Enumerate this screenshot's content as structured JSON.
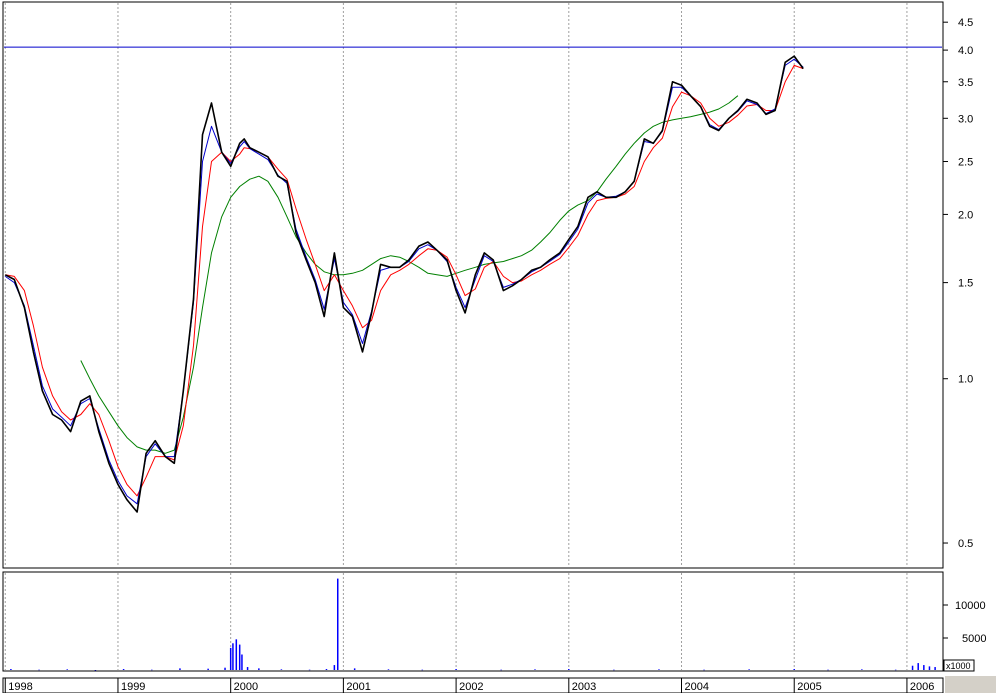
{
  "chart_data": {
    "type": "line",
    "title": "",
    "subtitle": "",
    "price_panel": {
      "scale": "log",
      "ylim": [
        0.45,
        4.9
      ],
      "y_ticks": [
        4.5,
        4.0,
        3.5,
        3.0,
        2.5,
        2.0,
        1.5,
        1.0,
        0.5
      ],
      "y_tick_labels": [
        "4.5",
        "4.0",
        "3.5",
        "3.0",
        "2.5",
        "2.0",
        "1.5",
        "1.0",
        "0.5"
      ],
      "reference_line": {
        "value": 4.05,
        "color": "#0000cc"
      },
      "series": [
        {
          "role": "price",
          "color": "#000000",
          "x": [
            1998.0,
            1998.08,
            1998.17,
            1998.25,
            1998.33,
            1998.42,
            1998.5,
            1998.58,
            1998.67,
            1998.75,
            1998.83,
            1998.92,
            1999.0,
            1999.08,
            1999.17,
            1999.25,
            1999.33,
            1999.42,
            1999.5,
            1999.58,
            1999.67,
            1999.75,
            1999.83,
            1999.92,
            2000.0,
            2000.08,
            2000.12,
            2000.17,
            2000.25,
            2000.33,
            2000.42,
            2000.5,
            2000.58,
            2000.67,
            2000.75,
            2000.83,
            2000.92,
            2001.0,
            2001.08,
            2001.17,
            2001.25,
            2001.33,
            2001.42,
            2001.5,
            2001.58,
            2001.67,
            2001.75,
            2001.83,
            2001.92,
            2002.0,
            2002.08,
            2002.17,
            2002.25,
            2002.33,
            2002.42,
            2002.5,
            2002.58,
            2002.67,
            2002.75,
            2002.83,
            2002.92,
            2003.0,
            2003.08,
            2003.17,
            2003.25,
            2003.33,
            2003.42,
            2003.5,
            2003.58,
            2003.67,
            2003.75,
            2003.83,
            2003.92,
            2004.0,
            2004.08,
            2004.17,
            2004.25,
            2004.33,
            2004.42,
            2004.5,
            2004.58,
            2004.67,
            2004.75,
            2004.83,
            2004.92,
            2005.0,
            2005.08,
            2005.17,
            2005.25,
            2005.33,
            2005.42,
            2005.5,
            2005.58,
            2005.67,
            2005.75,
            2005.83,
            2005.92,
            2006.0,
            2006.08,
            2006.17,
            2006.25,
            2006.3
          ],
          "y": [
            1.55,
            1.52,
            1.35,
            1.12,
            0.95,
            0.86,
            0.84,
            0.8,
            0.91,
            0.93,
            0.8,
            0.7,
            0.64,
            0.6,
            0.57,
            0.73,
            0.77,
            0.72,
            0.7,
            0.95,
            1.4,
            2.8,
            3.2,
            2.6,
            2.45,
            2.7,
            2.75,
            2.65,
            2.6,
            2.55,
            2.35,
            2.3,
            1.85,
            1.65,
            1.5,
            1.3,
            1.7,
            1.35,
            1.3,
            1.12,
            1.32,
            1.62,
            1.6,
            1.6,
            1.65,
            1.75,
            1.78,
            1.72,
            1.65,
            1.45,
            1.32,
            1.55,
            1.7,
            1.65,
            1.45,
            1.48,
            1.52,
            1.58,
            1.6,
            1.65,
            1.7,
            1.8,
            1.9,
            2.15,
            2.2,
            2.15,
            2.15,
            2.2,
            2.3,
            2.75,
            2.7,
            2.85,
            3.5,
            3.45,
            3.3,
            3.15,
            2.9,
            2.85,
            3.0,
            3.1,
            3.25,
            3.2,
            3.05,
            3.1,
            3.8,
            3.9,
            3.7
          ]
        },
        {
          "role": "fast moving average",
          "color": "#0000cc",
          "x": [
            1998.0,
            1998.08,
            1998.17,
            1998.25,
            1998.33,
            1998.42,
            1998.5,
            1998.58,
            1998.67,
            1998.75,
            1998.83,
            1998.92,
            1999.0,
            1999.08,
            1999.17,
            1999.25,
            1999.33,
            1999.42,
            1999.5,
            1999.58,
            1999.67,
            1999.75,
            1999.83,
            1999.92,
            2000.0,
            2000.08,
            2000.12,
            2000.17,
            2000.25,
            2000.33,
            2000.42,
            2000.5,
            2000.58,
            2000.67,
            2000.75,
            2000.83,
            2000.92,
            2001.0,
            2001.08,
            2001.17,
            2001.25,
            2001.33,
            2001.42,
            2001.5,
            2001.58,
            2001.67,
            2001.75,
            2001.83,
            2001.92,
            2002.0,
            2002.08,
            2002.17,
            2002.25,
            2002.33,
            2002.42,
            2002.5,
            2002.58,
            2002.67,
            2002.75,
            2002.83,
            2002.92,
            2003.0,
            2003.08,
            2003.17,
            2003.25,
            2003.33,
            2003.42,
            2003.5,
            2003.58,
            2003.67,
            2003.75,
            2003.83,
            2003.92,
            2004.0,
            2004.08,
            2004.17,
            2004.25,
            2004.33,
            2004.42,
            2004.5,
            2004.58,
            2004.67,
            2004.75,
            2004.83,
            2004.92,
            2005.0,
            2005.08,
            2005.17,
            2005.25,
            2005.33,
            2005.42,
            2005.5,
            2005.58,
            2005.67,
            2005.75,
            2005.83,
            2005.92,
            2006.0,
            2006.08,
            2006.17,
            2006.25,
            2006.3
          ],
          "y": [
            1.54,
            1.5,
            1.36,
            1.15,
            0.97,
            0.88,
            0.85,
            0.82,
            0.9,
            0.92,
            0.81,
            0.71,
            0.65,
            0.61,
            0.59,
            0.72,
            0.76,
            0.72,
            0.72,
            0.95,
            1.38,
            2.5,
            2.9,
            2.6,
            2.48,
            2.66,
            2.72,
            2.64,
            2.58,
            2.52,
            2.36,
            2.28,
            1.88,
            1.67,
            1.52,
            1.34,
            1.66,
            1.38,
            1.31,
            1.16,
            1.33,
            1.58,
            1.6,
            1.6,
            1.64,
            1.73,
            1.76,
            1.72,
            1.64,
            1.47,
            1.35,
            1.52,
            1.68,
            1.64,
            1.47,
            1.49,
            1.52,
            1.57,
            1.6,
            1.64,
            1.69,
            1.78,
            1.88,
            2.1,
            2.18,
            2.15,
            2.16,
            2.2,
            2.3,
            2.72,
            2.7,
            2.84,
            3.42,
            3.42,
            3.3,
            3.15,
            2.92,
            2.86,
            3.0,
            3.09,
            3.23,
            3.18,
            3.06,
            3.12,
            3.75,
            3.85,
            3.72
          ]
        },
        {
          "role": "medium moving average",
          "color": "#ff0000",
          "x": [
            1998.0,
            1998.08,
            1998.17,
            1998.25,
            1998.33,
            1998.42,
            1998.5,
            1998.58,
            1998.67,
            1998.75,
            1998.83,
            1998.92,
            1999.0,
            1999.08,
            1999.17,
            1999.25,
            1999.33,
            1999.42,
            1999.5,
            1999.58,
            1999.67,
            1999.75,
            1999.83,
            1999.92,
            2000.0,
            2000.08,
            2000.12,
            2000.17,
            2000.25,
            2000.33,
            2000.42,
            2000.5,
            2000.58,
            2000.67,
            2000.75,
            2000.83,
            2000.92,
            2001.0,
            2001.08,
            2001.17,
            2001.25,
            2001.33,
            2001.42,
            2001.5,
            2001.58,
            2001.67,
            2001.75,
            2001.83,
            2001.92,
            2002.0,
            2002.08,
            2002.17,
            2002.25,
            2002.33,
            2002.42,
            2002.5,
            2002.58,
            2002.67,
            2002.75,
            2002.83,
            2002.92,
            2003.0,
            2003.08,
            2003.17,
            2003.25,
            2003.33,
            2003.42,
            2003.5,
            2003.58,
            2003.67,
            2003.75,
            2003.83,
            2003.92,
            2004.0,
            2004.08,
            2004.17,
            2004.25,
            2004.33,
            2004.42,
            2004.5,
            2004.58,
            2004.67,
            2004.75,
            2004.83,
            2004.92,
            2005.0,
            2005.08,
            2005.17,
            2005.25,
            2005.33,
            2005.42,
            2005.5,
            2005.58,
            2005.67,
            2005.75,
            2005.83,
            2005.92,
            2006.0,
            2006.08,
            2006.17,
            2006.25,
            2006.3
          ],
          "y": [
            1.55,
            1.54,
            1.45,
            1.25,
            1.05,
            0.93,
            0.87,
            0.84,
            0.86,
            0.9,
            0.86,
            0.77,
            0.69,
            0.64,
            0.61,
            0.66,
            0.72,
            0.72,
            0.71,
            0.82,
            1.15,
            1.9,
            2.5,
            2.6,
            2.5,
            2.58,
            2.65,
            2.64,
            2.6,
            2.55,
            2.42,
            2.32,
            2.05,
            1.8,
            1.62,
            1.45,
            1.55,
            1.45,
            1.36,
            1.24,
            1.28,
            1.45,
            1.55,
            1.58,
            1.62,
            1.68,
            1.73,
            1.72,
            1.67,
            1.55,
            1.42,
            1.46,
            1.6,
            1.64,
            1.54,
            1.5,
            1.51,
            1.55,
            1.58,
            1.62,
            1.66,
            1.74,
            1.83,
            2.0,
            2.12,
            2.14,
            2.15,
            2.18,
            2.25,
            2.5,
            2.65,
            2.76,
            3.15,
            3.35,
            3.3,
            3.2,
            3.0,
            2.9,
            2.95,
            3.04,
            3.16,
            3.18,
            3.1,
            3.1,
            3.5,
            3.75,
            3.7
          ]
        },
        {
          "role": "slow moving average",
          "color": "#008000",
          "x": [
            1998.67,
            1998.75,
            1998.83,
            1998.92,
            1999.0,
            1999.08,
            1999.17,
            1999.25,
            1999.33,
            1999.42,
            1999.5,
            1999.58,
            1999.67,
            1999.75,
            1999.83,
            1999.92,
            2000.0,
            2000.08,
            2000.17,
            2000.25,
            2000.33,
            2000.42,
            2000.5,
            2000.58,
            2000.67,
            2000.75,
            2000.83,
            2000.92,
            2001.0,
            2001.08,
            2001.17,
            2001.25,
            2001.33,
            2001.42,
            2001.5,
            2001.58,
            2001.67,
            2001.75,
            2001.83,
            2001.92,
            2002.0,
            2002.08,
            2002.17,
            2002.25,
            2002.33,
            2002.42,
            2002.5,
            2002.58,
            2002.67,
            2002.75,
            2002.83,
            2002.92,
            2003.0,
            2003.08,
            2003.17,
            2003.25,
            2003.33,
            2003.42,
            2003.5,
            2003.58,
            2003.67,
            2003.75,
            2003.83,
            2003.92,
            2004.0,
            2004.08,
            2004.17,
            2004.25,
            2004.33,
            2004.42,
            2004.5,
            2004.58,
            2004.67,
            2004.75,
            2004.83,
            2004.92,
            2005.0,
            2005.08,
            2005.17,
            2005.25,
            2005.33,
            2005.42,
            2005.5,
            2005.58,
            2005.67,
            2005.75,
            2005.83,
            2005.92,
            2006.0,
            2006.08,
            2006.17,
            2006.25,
            2006.3
          ],
          "y": [
            1.08,
            1.0,
            0.93,
            0.87,
            0.82,
            0.78,
            0.75,
            0.74,
            0.74,
            0.73,
            0.74,
            0.85,
            1.05,
            1.35,
            1.7,
            1.98,
            2.15,
            2.25,
            2.32,
            2.35,
            2.3,
            2.15,
            1.98,
            1.82,
            1.7,
            1.62,
            1.57,
            1.55,
            1.55,
            1.56,
            1.58,
            1.62,
            1.66,
            1.68,
            1.67,
            1.64,
            1.6,
            1.56,
            1.55,
            1.54,
            1.56,
            1.58,
            1.6,
            1.62,
            1.63,
            1.64,
            1.66,
            1.68,
            1.72,
            1.78,
            1.85,
            1.95,
            2.03,
            2.08,
            2.12,
            2.2,
            2.32,
            2.45,
            2.58,
            2.7,
            2.82,
            2.9,
            2.95,
            2.98,
            3.0,
            3.02,
            3.05,
            3.08,
            3.12,
            3.2,
            3.3
          ]
        }
      ]
    },
    "volume_panel": {
      "y_ticks": [
        5000,
        10000
      ],
      "y_tick_labels": [
        "5000",
        "10000"
      ],
      "ylim": [
        0,
        15000
      ],
      "unit_label": "x1000",
      "color": "#0000ff",
      "x": [
        1998.05,
        1998.3,
        1998.55,
        1998.8,
        1999.05,
        1999.3,
        1999.55,
        1999.8,
        1999.95,
        2000.0,
        2000.02,
        2000.05,
        2000.08,
        2000.1,
        2000.15,
        2000.25,
        2000.45,
        2000.7,
        2000.85,
        2000.92,
        2000.95,
        2001.1,
        2001.4,
        2001.7,
        2002.0,
        2002.4,
        2002.7,
        2003.0,
        2003.4,
        2003.8,
        2004.2,
        2004.6,
        2005.0,
        2005.3,
        2005.6,
        2005.9,
        2006.05,
        2006.1,
        2006.15,
        2006.2,
        2006.25
      ],
      "values": [
        300,
        200,
        250,
        150,
        300,
        200,
        400,
        350,
        500,
        3500,
        4200,
        4800,
        4000,
        2500,
        600,
        400,
        250,
        200,
        300,
        900,
        14000,
        400,
        250,
        200,
        300,
        200,
        250,
        300,
        200,
        250,
        200,
        250,
        300,
        200,
        250,
        200,
        800,
        1200,
        900,
        700,
        600
      ]
    },
    "x_axis": {
      "type": "date",
      "xlim": [
        1997.98,
        2006.32
      ],
      "ticks": [
        1998.0,
        1999.0,
        2000.0,
        2001.0,
        2002.0,
        2003.0,
        2004.0,
        2005.0,
        2006.0
      ],
      "tick_labels": [
        "1998",
        "1999",
        "2000",
        "2001",
        "2002",
        "2003",
        "2004",
        "2005",
        "2006"
      ]
    },
    "grid": true,
    "legend": "none"
  }
}
